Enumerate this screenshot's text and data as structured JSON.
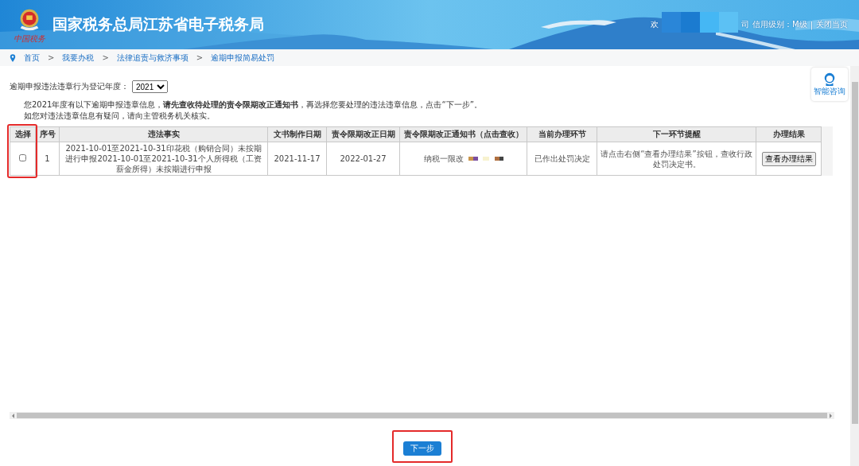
{
  "header": {
    "logo_caption": "中国税务",
    "title": "国家税务总局江苏省电子税务局",
    "welcome": "欢",
    "welcome_tail": "司",
    "credit_level": "信用级别：M级",
    "separator": "|",
    "close_link": "关闭当页"
  },
  "breadcrumb": [
    "首页",
    "我要办税",
    "法律追责与救济事项",
    "逾期申报简易处罚"
  ],
  "breadcrumb_separator": ">",
  "help": {
    "label": "智能咨询"
  },
  "year_filter": {
    "label": "逾期申报违法违章行为登记年度：",
    "value": "2021"
  },
  "notice": {
    "text": "您2021年度有以下逾期申报违章信息，**请先查收待处理的责令限期改正通知书**，再选择您要处理的违法违章信息，点击“下一步”。",
    "line2": "如您对违法违章信息有疑问，请向主管税务机关核实。"
  },
  "table": {
    "columns": [
      "选择",
      "序号",
      "违法事实",
      "文书制作日期",
      "责令限期改正日期",
      "责令限期改正通知书（点击查收）",
      "当前办理环节",
      "下一环节提醒",
      "办理结果"
    ],
    "rows": [
      {
        "checked": false,
        "index": "1",
        "fact": "2021-10-01至2021-10-31印花税（购销合同）未按期进行申报2021-10-01至2021-10-31个人所得税（工资薪金所得）未按期进行申报",
        "doc_date": "2021-11-17",
        "deadline": "2022-01-27",
        "notice_link": "纳税一限改",
        "stage": "已作出处罚决定",
        "reminder": "请点击右侧“查看办理结果”按钮，查收行政处罚决定书。",
        "result_button": "查看办理结果"
      }
    ]
  },
  "next_button": "下一步"
}
